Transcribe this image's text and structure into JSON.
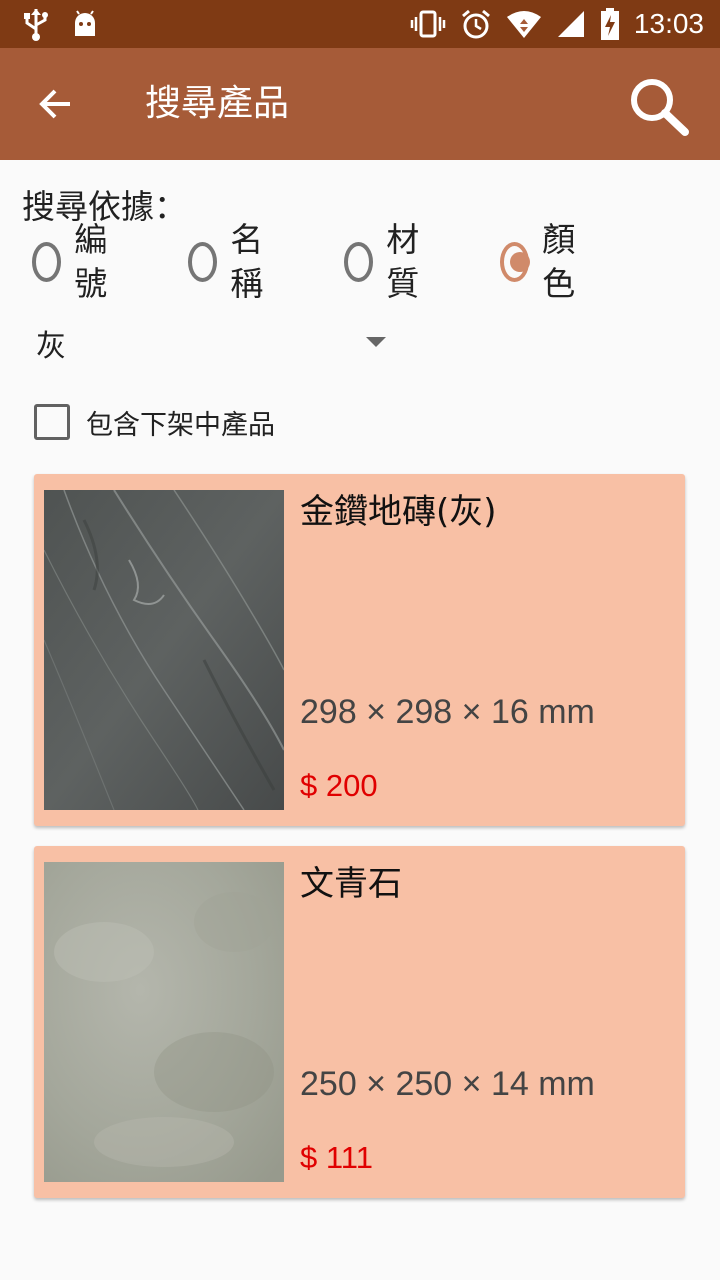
{
  "status_bar": {
    "time": "13:03",
    "left_icons": [
      "usb-icon",
      "android-icon"
    ],
    "right_icons": [
      "vibrate-icon",
      "alarm-icon",
      "wifi-icon",
      "signal-icon",
      "battery-charging-icon"
    ]
  },
  "app_bar": {
    "title": "搜尋產品",
    "background": "#a65b38",
    "status_background": "#7f3a14"
  },
  "search_form": {
    "label": "搜尋依據：",
    "options": [
      {
        "label": "編號",
        "checked": false
      },
      {
        "label": "名稱",
        "checked": false
      },
      {
        "label": "材質",
        "checked": false
      },
      {
        "label": "顏色",
        "checked": true
      }
    ],
    "selected_color": "灰",
    "include_unlisted_label": "包含下架中產品",
    "include_unlisted_checked": false
  },
  "products": [
    {
      "name": "金鑽地磚(灰)",
      "size": "298 × 298 ×  16 mm",
      "price": "$ 200"
    },
    {
      "name": "文青石",
      "size": "250 × 250 ×  14 mm",
      "price": "$ 111"
    }
  ],
  "colors": {
    "card_background": "#f8c0a5",
    "price": "#e00000",
    "radio_accent": "#d08a6a"
  }
}
